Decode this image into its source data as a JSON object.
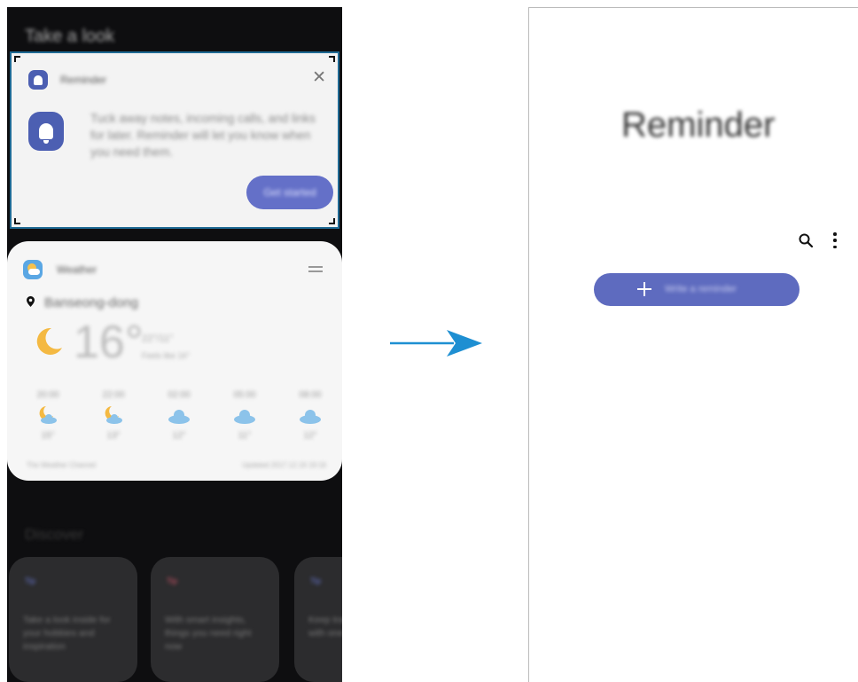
{
  "left_screen": {
    "header": "Take a look",
    "reminder_card": {
      "app_name": "Reminder",
      "description": "Tuck away notes, incoming calls, and links for later. Reminder will let you know when you need them.",
      "button_label": "Get started",
      "close_icon": "close-icon"
    },
    "weather_card": {
      "app_name": "Weather",
      "location": "Banseong-dong",
      "temperature": "16°",
      "temp_range": "22°/11°",
      "feels_like": "Feels like 16°",
      "forecast": [
        {
          "time": "20:00",
          "icon": "moon-cloud-icon",
          "temp": "15°"
        },
        {
          "time": "22:00",
          "icon": "moon-cloud-icon",
          "temp": "13°"
        },
        {
          "time": "02:00",
          "icon": "cloud-icon",
          "temp": "12°"
        },
        {
          "time": "05:00",
          "icon": "cloud-icon",
          "temp": "11°"
        },
        {
          "time": "08:00",
          "icon": "cloud-icon",
          "temp": "12°"
        }
      ],
      "source": "The Weather Channel",
      "updated": "Updated 2017.12.19 19:16"
    },
    "discover": {
      "title": "Discover",
      "cards": [
        {
          "tag": "Tip",
          "tag_color": "#6a7ad8",
          "text": "Take a look inside for your hobbies and inspiration"
        },
        {
          "tag": "Tip",
          "tag_color": "#d8556a",
          "text": "With smart insights, things you need right now"
        },
        {
          "tag": "Tip",
          "tag_color": "#6a7ad8",
          "text": "Keep track of your day with one view"
        }
      ]
    }
  },
  "right_screen": {
    "title": "Reminder",
    "add_button_label": "Write a reminder",
    "search_icon": "search-icon",
    "more_icon": "more-options-icon"
  },
  "colors": {
    "accent": "#5e6bbf",
    "focus_frame": "#1f6a94",
    "arrow": "#1e8fd2"
  }
}
